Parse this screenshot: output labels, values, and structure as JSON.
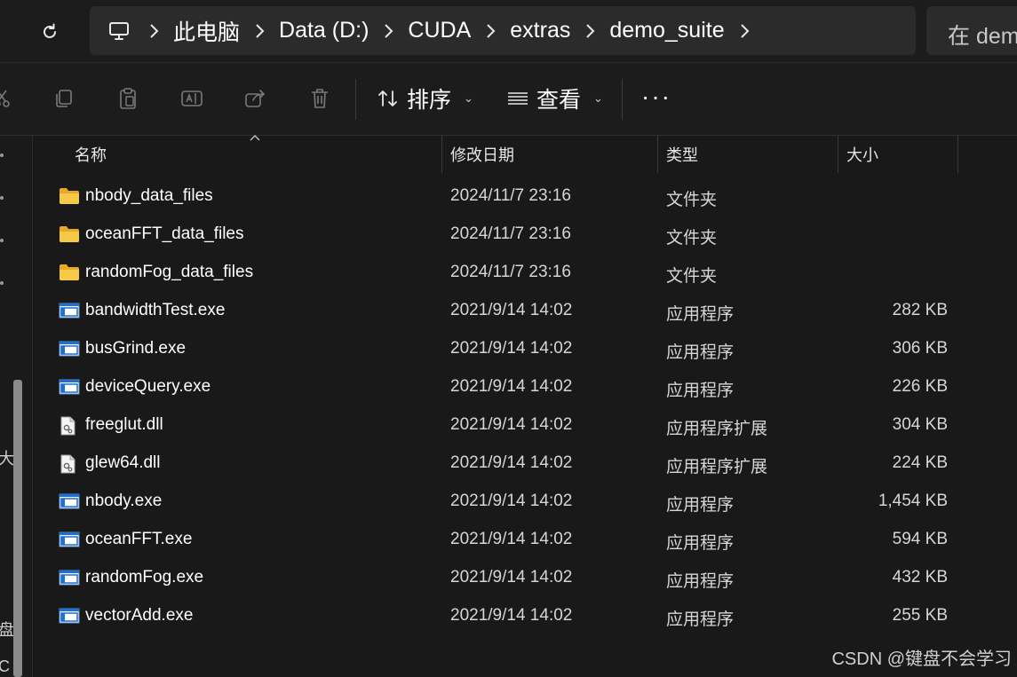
{
  "address_bar": {
    "breadcrumbs": [
      "此电脑",
      "Data (D:)",
      "CUDA",
      "extras",
      "demo_suite"
    ],
    "search_placeholder": "在 dem"
  },
  "toolbar": {
    "sort_label": "排序",
    "view_label": "查看",
    "more_label": "···"
  },
  "columns": {
    "name": "名称",
    "date": "修改日期",
    "type": "类型",
    "size": "大小"
  },
  "files": [
    {
      "name": "nbody_data_files",
      "date": "2024/11/7 23:16",
      "type": "文件夹",
      "size": "",
      "icon": "folder-icon"
    },
    {
      "name": "oceanFFT_data_files",
      "date": "2024/11/7 23:16",
      "type": "文件夹",
      "size": "",
      "icon": "folder-icon"
    },
    {
      "name": "randomFog_data_files",
      "date": "2024/11/7 23:16",
      "type": "文件夹",
      "size": "",
      "icon": "folder-icon"
    },
    {
      "name": "bandwidthTest.exe",
      "date": "2021/9/14 14:02",
      "type": "应用程序",
      "size": "282 KB",
      "icon": "exe-icon"
    },
    {
      "name": "busGrind.exe",
      "date": "2021/9/14 14:02",
      "type": "应用程序",
      "size": "306 KB",
      "icon": "exe-icon"
    },
    {
      "name": "deviceQuery.exe",
      "date": "2021/9/14 14:02",
      "type": "应用程序",
      "size": "226 KB",
      "icon": "exe-icon"
    },
    {
      "name": "freeglut.dll",
      "date": "2021/9/14 14:02",
      "type": "应用程序扩展",
      "size": "304 KB",
      "icon": "dll-icon"
    },
    {
      "name": "glew64.dll",
      "date": "2021/9/14 14:02",
      "type": "应用程序扩展",
      "size": "224 KB",
      "icon": "dll-icon"
    },
    {
      "name": "nbody.exe",
      "date": "2021/9/14 14:02",
      "type": "应用程序",
      "size": "1,454 KB",
      "icon": "exe-icon"
    },
    {
      "name": "oceanFFT.exe",
      "date": "2021/9/14 14:02",
      "type": "应用程序",
      "size": "594 KB",
      "icon": "exe-icon"
    },
    {
      "name": "randomFog.exe",
      "date": "2021/9/14 14:02",
      "type": "应用程序",
      "size": "432 KB",
      "icon": "exe-icon"
    },
    {
      "name": "vectorAdd.exe",
      "date": "2021/9/14 14:02",
      "type": "应用程序",
      "size": "255 KB",
      "icon": "exe-icon"
    }
  ],
  "nav_partial_glyphs": [
    "大",
    "盘",
    "C"
  ],
  "watermark": "CSDN @键盘不会学习",
  "colors": {
    "background": "#191919",
    "address_field": "#2b2b2b",
    "folder": "#f7c948",
    "exe_accent": "#1e6fd0"
  }
}
